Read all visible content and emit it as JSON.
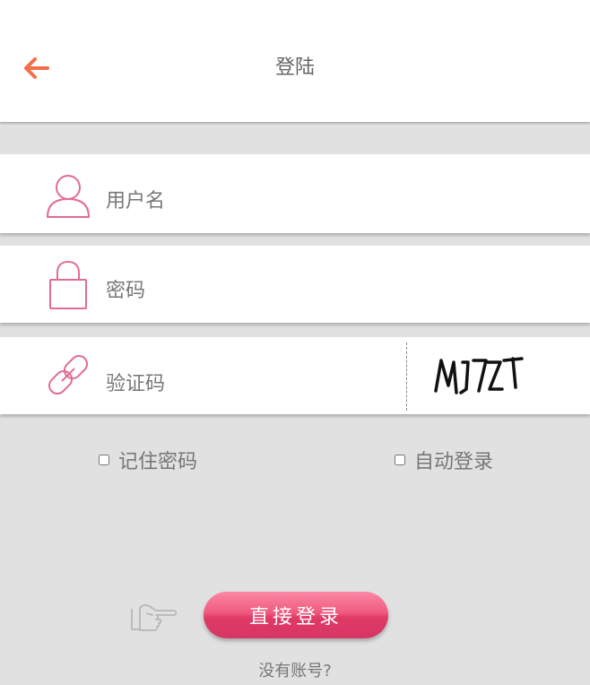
{
  "header": {
    "title": "登陆",
    "back_icon": "arrow-left-icon",
    "accent_color": "#f36f4a"
  },
  "form": {
    "username": {
      "placeholder": "用户名",
      "value": "",
      "icon": "user-icon"
    },
    "password": {
      "placeholder": "密码",
      "value": "",
      "icon": "lock-icon"
    },
    "captcha": {
      "placeholder": "验证码",
      "value": "",
      "icon": "link-icon",
      "image_text": "MJ7ZT"
    },
    "icon_color": "#e26c94"
  },
  "options": {
    "remember_password": {
      "label": "记住密码",
      "checked": false
    },
    "auto_login": {
      "label": "自动登录",
      "checked": false
    }
  },
  "actions": {
    "login_label": "直接登录",
    "pointer_icon": "pointing-hand-icon",
    "register_label": "没有账号?"
  }
}
